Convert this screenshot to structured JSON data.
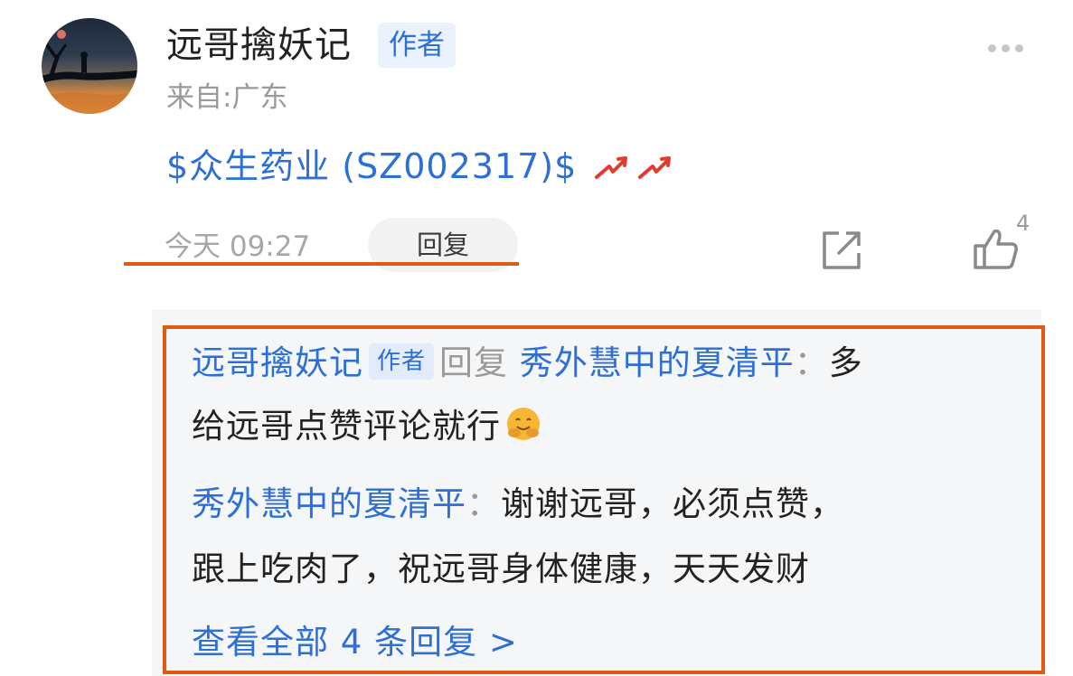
{
  "post": {
    "author": "远哥擒妖记",
    "author_tag": "作者",
    "location": "来自:广东",
    "stock_link": "$众生药业 (SZ002317)$",
    "time": "今天 09:27",
    "reply_label": "回复",
    "like_count": "4"
  },
  "replies": {
    "first": {
      "author": "远哥擒妖记",
      "author_tag": "作者",
      "verb": "回复",
      "target": "秀外慧中的夏清平",
      "colon": "：",
      "text_line1": "多",
      "text_line2": "给远哥点赞评论就行"
    },
    "second": {
      "author": "秀外慧中的夏清平",
      "colon": "：",
      "text_line1": "谢谢远哥，必须点赞，",
      "text_line2": "跟上吃肉了，祝远哥身体健康，天天发财"
    },
    "view_all": "查看全部 4 条回复 >"
  },
  "icons": {
    "more": "more-dots-icon",
    "rise": "rising-arrows-icon",
    "share": "share-icon",
    "like": "thumbs-up-icon",
    "emoji": "hugging-face-emoji-icon"
  },
  "colors": {
    "link_blue": "#2c6fd6",
    "highlight_orange": "#e05a12",
    "rise_red": "#e33b2e"
  }
}
